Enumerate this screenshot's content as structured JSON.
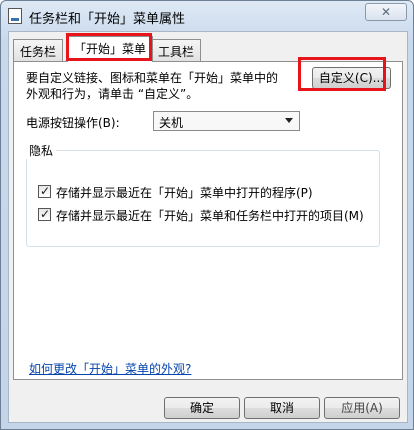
{
  "window": {
    "title": "任务栏和「开始」菜单属性",
    "close_label": "✕"
  },
  "tabs": [
    {
      "label": "任务栏",
      "active": false
    },
    {
      "label": "「开始」菜单",
      "active": true
    },
    {
      "label": "工具栏",
      "active": false
    }
  ],
  "start_menu": {
    "description_line1": "要自定义链接、图标和菜单在「开始」菜单中的",
    "description_line2": "外观和行为，请单击 “自定义”。",
    "customize_button": "自定义(C)...",
    "power_button_label": "电源按钮操作(B):",
    "power_button_value": "关机",
    "privacy_group_title": "隐私",
    "privacy_options": [
      {
        "label": "存储并显示最近在「开始」菜单中打开的程序(P)",
        "checked": true
      },
      {
        "label": "存储并显示最近在「开始」菜单和任务栏中打开的项目(M)",
        "checked": true
      }
    ],
    "help_link": "如何更改「开始」菜单的外观?"
  },
  "footer": {
    "ok_button": "确定",
    "cancel_button": "取消",
    "apply_button": "应用(A)"
  },
  "annotation": {
    "highlight_color": "#e8141b"
  },
  "icons": {
    "app": "taskbar-properties-icon",
    "close": "close-icon",
    "dropdown": "chevron-down-icon",
    "check": "checkmark-icon"
  }
}
